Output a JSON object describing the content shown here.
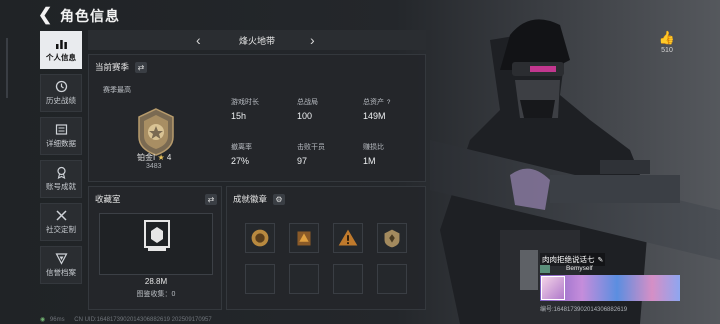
{
  "header": {
    "title": "角色信息"
  },
  "sidebar": {
    "items": [
      {
        "label": "个人信息",
        "icon": "bar-chart-icon",
        "active": true
      },
      {
        "label": "历史战绩",
        "icon": "history-icon",
        "active": false
      },
      {
        "label": "详细数据",
        "icon": "details-icon",
        "active": false
      },
      {
        "label": "账号成就",
        "icon": "achievement-icon",
        "active": false
      },
      {
        "label": "社交定制",
        "icon": "social-icon",
        "active": false
      },
      {
        "label": "信誉档案",
        "icon": "reputation-icon",
        "active": false
      }
    ]
  },
  "map": {
    "name": "烽火地带"
  },
  "season": {
    "heading": "当前赛季",
    "subheading": "赛季最高",
    "rank_name": "铂金I",
    "rank_stars": "★",
    "rank_level": "4",
    "rank_score": "3483",
    "stats": [
      {
        "label": "游戏时长",
        "value": "15h"
      },
      {
        "label": "总战局",
        "value": "100"
      },
      {
        "label": "总资产",
        "value": "149M",
        "help": "?"
      },
      {
        "label": "撤离率",
        "value": "27%"
      },
      {
        "label": "击败干员",
        "value": "97"
      },
      {
        "label": "赚损比",
        "value": "1M"
      }
    ]
  },
  "collection": {
    "heading": "收藏室",
    "value": "28.8M",
    "count_text": "图鉴收集：0"
  },
  "achievements": {
    "heading": "成就徽章",
    "slots": [
      "gold-emblem-badge",
      "warning-crate-badge",
      "warning-triangle-badge",
      "shield-emblem-badge",
      "",
      "",
      "",
      ""
    ]
  },
  "like": {
    "count": "510"
  },
  "player_card": {
    "name": "肉肉拒绝说话七",
    "id_name": "Bemyself",
    "number": "编号:1648173902014306882619"
  },
  "footer": {
    "ping": "96ms",
    "uid": "CN UID:1648173902014306882619 202509170957"
  },
  "colors": {
    "accent_gold": "#e8c25a",
    "active_tab": "#e9ebee",
    "ping_green": "#6fae6f"
  }
}
